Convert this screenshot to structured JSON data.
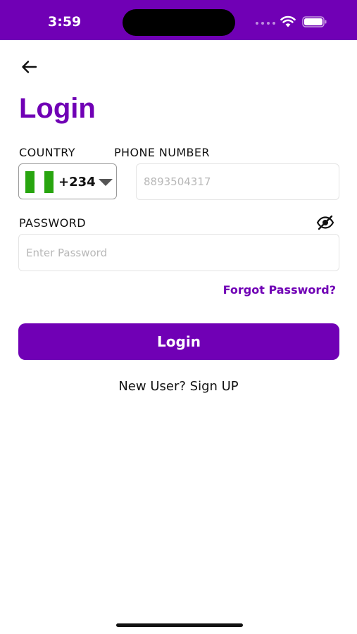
{
  "status_bar": {
    "time": "3:59",
    "background_color": "#7000b5",
    "icons": [
      "signal-icon",
      "wifi-icon",
      "battery-icon"
    ]
  },
  "navigation": {
    "back_icon": "arrow-left-icon"
  },
  "page": {
    "title": "Login",
    "accent_color": "#7000b5"
  },
  "form": {
    "country": {
      "label": "COUNTRY",
      "flag_icon": "nigeria-flag-icon",
      "code": "+234"
    },
    "phone": {
      "label": "PHONE NUMBER",
      "value": "",
      "placeholder": "8893504317"
    },
    "password": {
      "label": "PASSWORD",
      "value": "",
      "placeholder": "Enter Password",
      "toggle_icon": "eye-off-icon"
    },
    "forgot_password_label": "Forgot Password?",
    "login_label": "Login",
    "signup_prompt": "New User? ",
    "signup_link": "Sign UP"
  }
}
